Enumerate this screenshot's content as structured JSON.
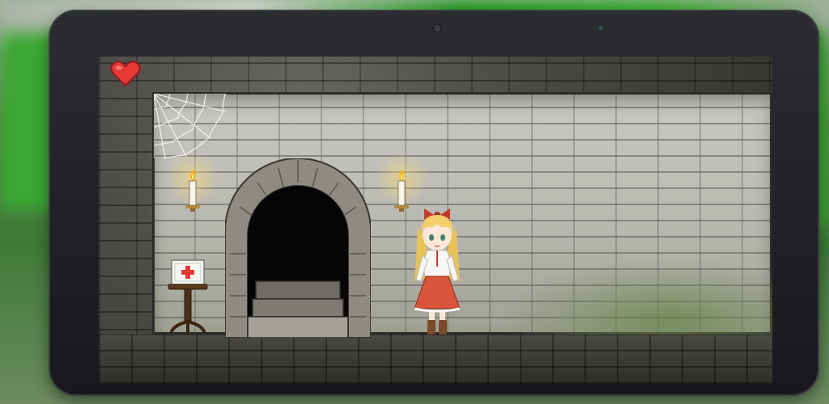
{
  "game": {
    "hud": {
      "lives_icon": "heart-icon",
      "lives_color": "#e53935"
    },
    "scene": {
      "objects": [
        "cobweb",
        "candle",
        "candle",
        "stone-archway",
        "first-aid-kit",
        "girl-character"
      ],
      "colors": {
        "wall": "#c0bfb8",
        "outer_wall": "#45433e",
        "girl_dress": "#d9543a",
        "girl_hair": "#f2cf6a",
        "first_aid_cross": "#e53935"
      }
    }
  }
}
